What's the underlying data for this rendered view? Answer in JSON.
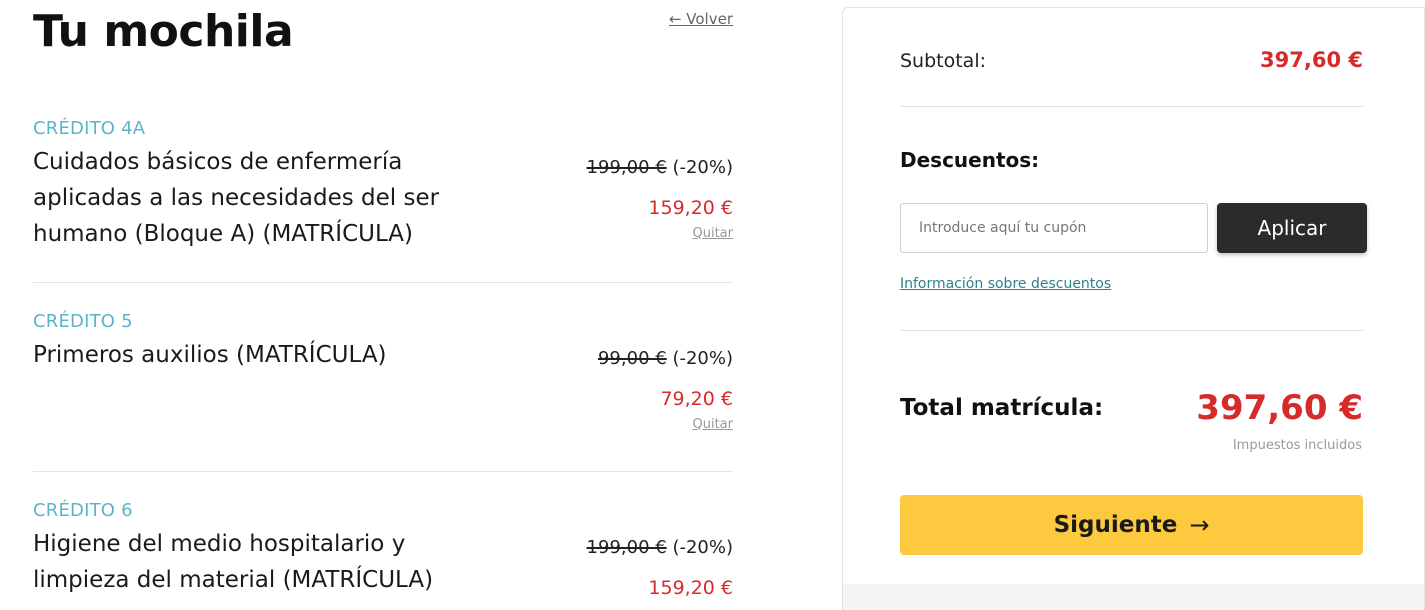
{
  "header": {
    "title": "Tu mochila",
    "back_label": "← Volver"
  },
  "cart": {
    "items": [
      {
        "credit": "CRÉDITO 4A",
        "name": "Cuidados básicos de enfermería aplicadas a las necesidades del ser humano (Bloque A) (MATRÍCULA)",
        "old_price": "199,00 €",
        "discount": "(-20%)",
        "new_price": "159,20 €",
        "remove_label": "Quitar"
      },
      {
        "credit": "CRÉDITO 5",
        "name": "Primeros auxilios (MATRÍCULA)",
        "old_price": "99,00 €",
        "discount": "(-20%)",
        "new_price": "79,20 €",
        "remove_label": "Quitar"
      },
      {
        "credit": "CRÉDITO 6",
        "name": "Higiene del medio hospitalario y limpieza del material (MATRÍCULA)",
        "old_price": "199,00 €",
        "discount": "(-20%)",
        "new_price": "159,20 €"
      }
    ]
  },
  "summary": {
    "subtotal_label": "Subtotal:",
    "subtotal_value": "397,60 €",
    "discounts_title": "Descuentos:",
    "coupon_placeholder": "Introduce aquí tu cupón",
    "apply_label": "Aplicar",
    "discount_info_label": "Información sobre descuentos",
    "total_label": "Total matrícula:",
    "total_value": "397,60 €",
    "tax_note": "Impuestos incluidos",
    "next_label": "Siguiente",
    "next_icon": "arrow-right-icon"
  },
  "colors": {
    "accent_red": "#d62b2b",
    "credit_teal": "#5bb5c8",
    "next_button": "#fdc93e",
    "apply_button": "#2b2b2b"
  }
}
